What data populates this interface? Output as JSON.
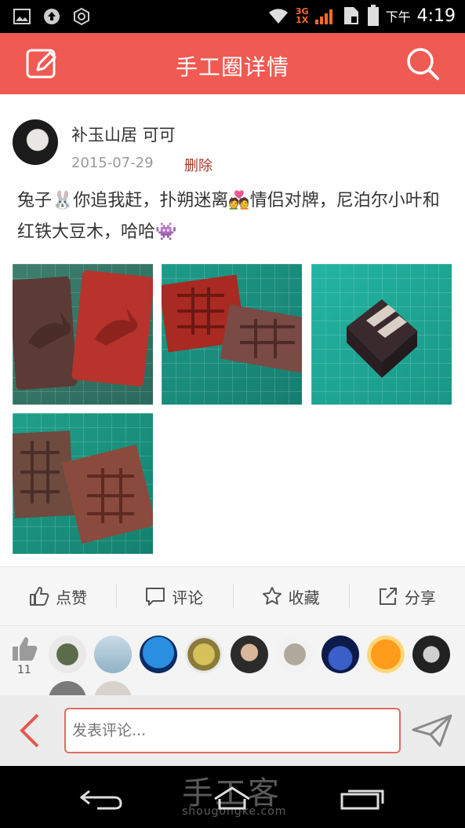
{
  "status_bar": {
    "network_label": "3G\n1X",
    "ampm": "下午",
    "time": "4:19"
  },
  "app_bar": {
    "title": "手工圈详情"
  },
  "post": {
    "author": "补玉山居 可可",
    "date": "2015-07-29",
    "delete_label": "删除",
    "text": "兔子🐰你追我赶，扑朔迷离💑情侣对牌，尼泊尔小叶和红铁大豆木，哈哈👾"
  },
  "actions": [
    {
      "label": "点赞",
      "icon": "thumbs-up-icon"
    },
    {
      "label": "评论",
      "icon": "comment-icon"
    },
    {
      "label": "收藏",
      "icon": "star-icon"
    },
    {
      "label": "分享",
      "icon": "share-icon"
    }
  ],
  "likes": {
    "count": "11"
  },
  "comment_bar": {
    "placeholder": "发表评论..."
  },
  "nav_bar": {
    "watermark": "手工客",
    "watermark_url": "shougongke.com"
  },
  "colors": {
    "accent": "#ef5a52",
    "delete": "#a83a2a"
  }
}
